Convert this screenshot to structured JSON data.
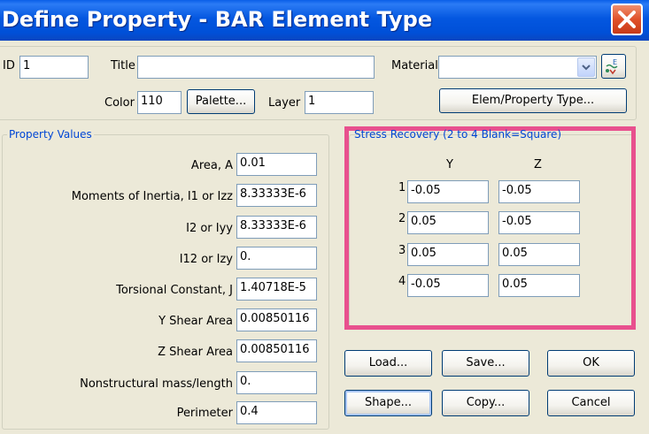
{
  "window": {
    "title": "Define Property - BAR Element Type"
  },
  "header": {
    "id_label": "ID",
    "id_value": "1",
    "title_label": "Title",
    "title_value": "",
    "material_label": "Material",
    "material_value": "",
    "color_label": "Color",
    "color_value": "110",
    "palette_button": "Palette...",
    "layer_label": "Layer",
    "layer_value": "1",
    "elem_property_type_button": "Elem/Property Type...",
    "material_browse_icon_text": "E"
  },
  "property_values": {
    "group_title": "Property Values",
    "rows": [
      {
        "label": "Area,  A",
        "value": "0.01"
      },
      {
        "label": "Moments of Inertia,  I1 or Izz",
        "value": "8.33333E-6"
      },
      {
        "label": "I2 or Iyy",
        "value": "8.33333E-6"
      },
      {
        "label": "I12 or Izy",
        "value": "0."
      },
      {
        "label": "Torsional Constant,  J",
        "value": "1.40718E-5"
      },
      {
        "label": "Y Shear Area",
        "value": "0.00850116"
      },
      {
        "label": "Z Shear Area",
        "value": "0.00850116"
      },
      {
        "label": "Nonstructural mass/length",
        "value": "0."
      },
      {
        "label": "Perimeter",
        "value": "0.4"
      }
    ]
  },
  "stress_recovery": {
    "group_title": "Stress Recovery (2 to 4 Blank=Square)",
    "col_y": "Y",
    "col_z": "Z",
    "rows": [
      {
        "num": "1",
        "y": "-0.05",
        "z": "-0.05"
      },
      {
        "num": "2",
        "y": "0.05",
        "z": "-0.05"
      },
      {
        "num": "3",
        "y": "0.05",
        "z": "0.05"
      },
      {
        "num": "4",
        "y": "-0.05",
        "z": "0.05"
      }
    ],
    "highlight_color": "#E8508E"
  },
  "buttons": {
    "load": "Load...",
    "save": "Save...",
    "ok": "OK",
    "shape": "Shape...",
    "copy": "Copy...",
    "cancel": "Cancel"
  },
  "colors": {
    "titlebar": "#0457E0",
    "dialog_bg": "#ECE9D8",
    "group_title": "#0046D5",
    "close_button": "#E0502A"
  }
}
